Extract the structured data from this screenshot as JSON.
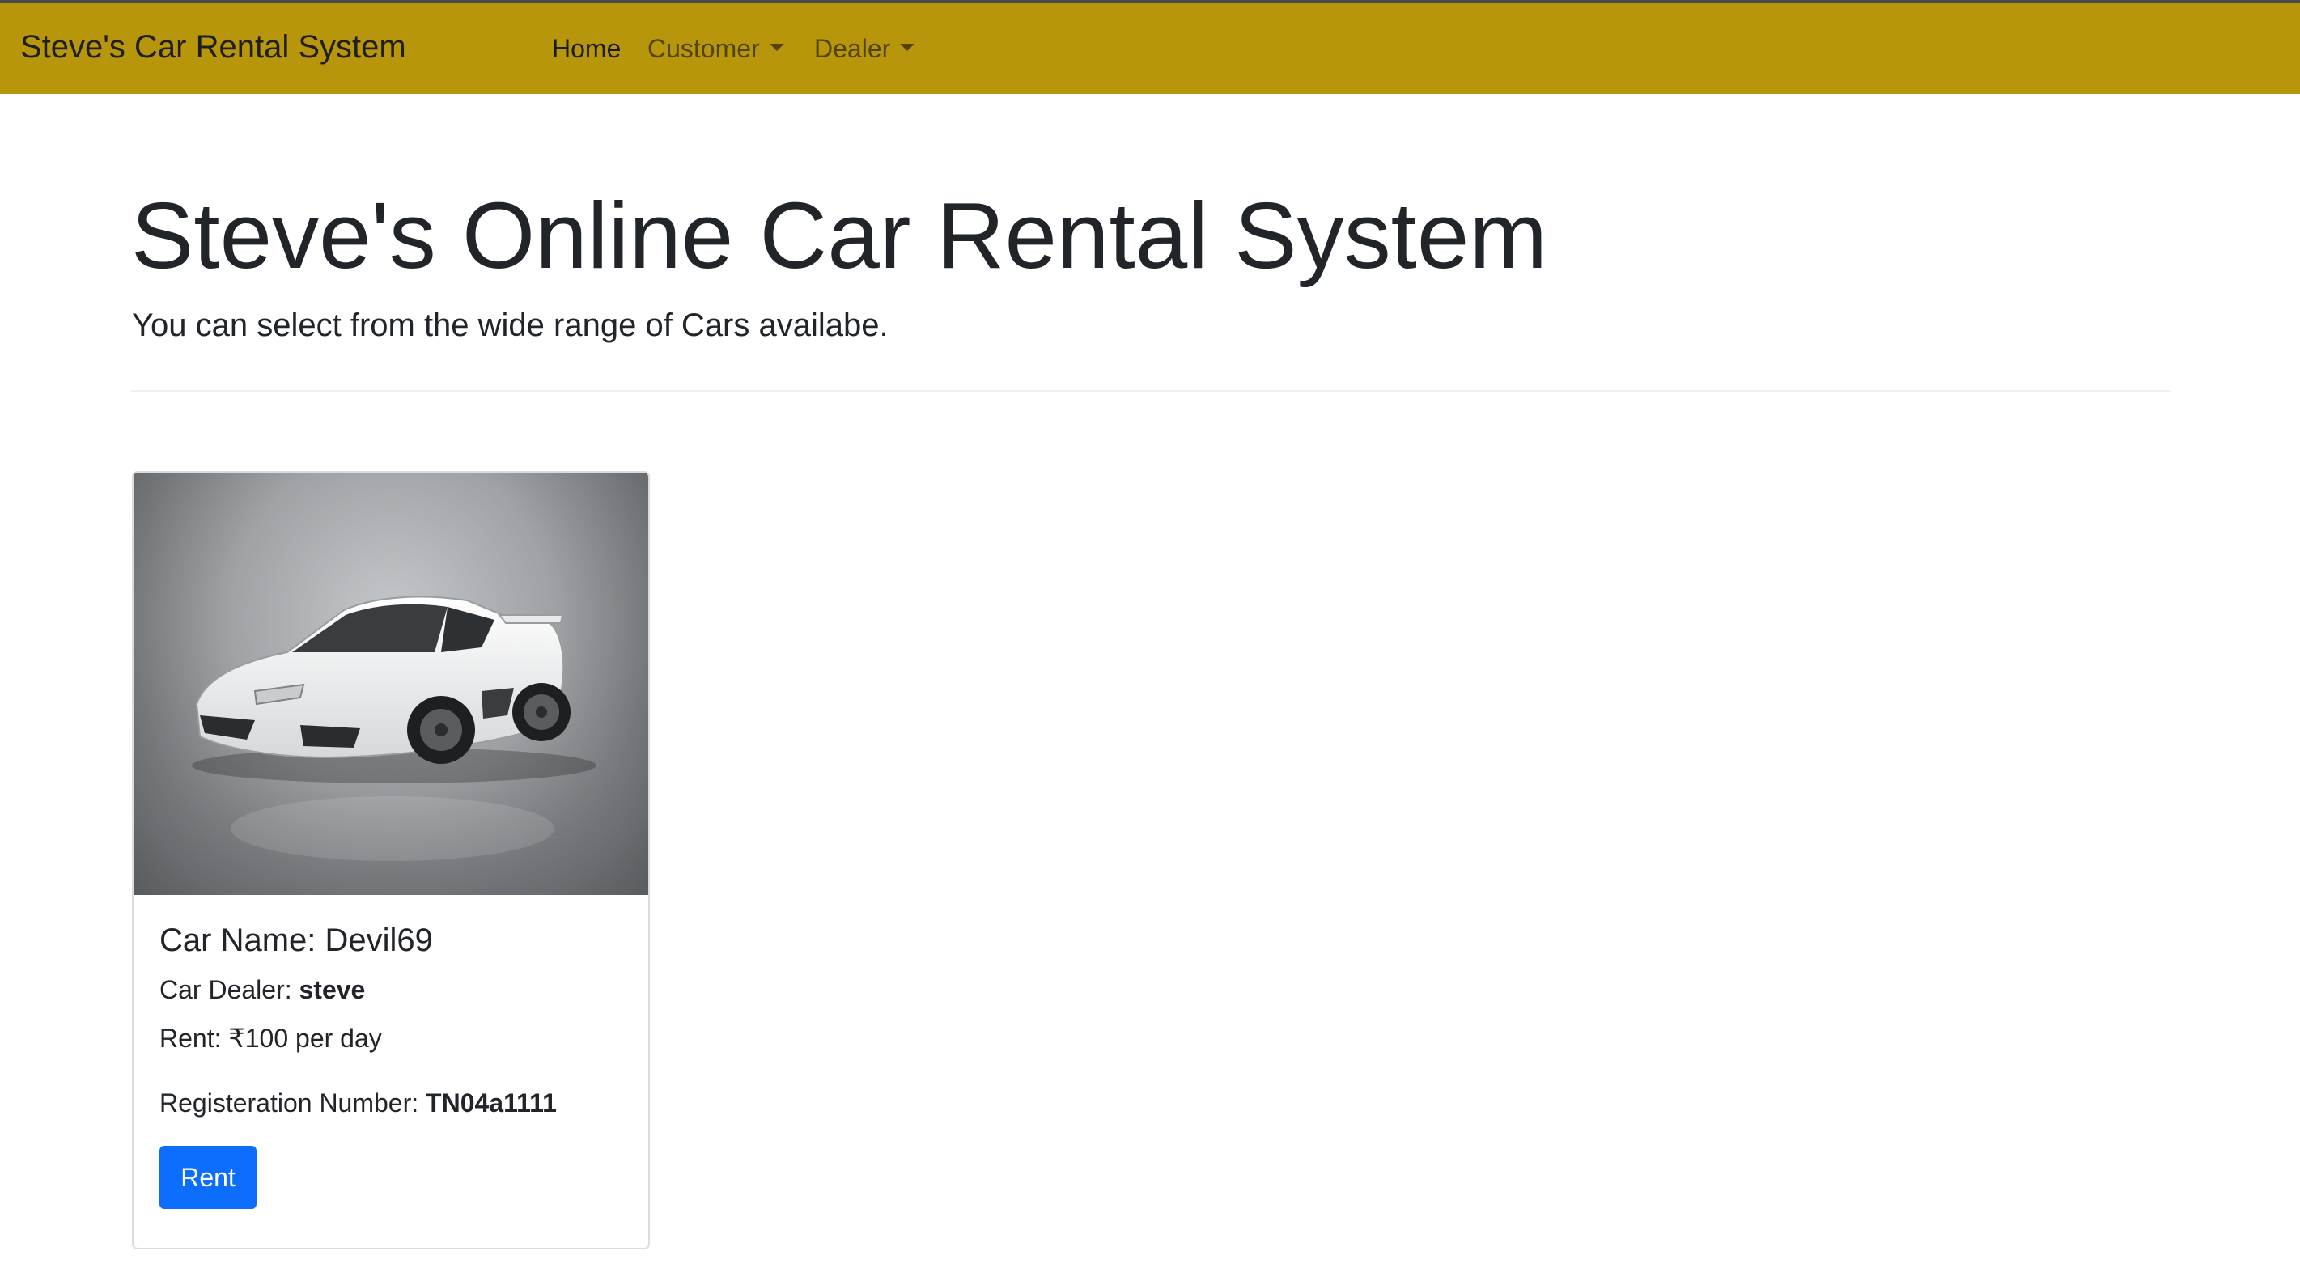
{
  "navbar": {
    "brand": "Steve's Car Rental System",
    "items": [
      {
        "label": "Home"
      },
      {
        "label": "Customer"
      },
      {
        "label": "Dealer"
      }
    ],
    "background_color": "#b8960b"
  },
  "hero": {
    "title": "Steve's Online Car Rental System",
    "lead": "You can select from the wide range of Cars availabe."
  },
  "cars": [
    {
      "name_label": "Car Name: Devil69",
      "dealer_label": "Car Dealer: ",
      "dealer": "steve",
      "rent": "Rent: ₹100 per day",
      "reg_label": "Registeration Number: ",
      "reg_number": "TN04a1111",
      "button_label": "Rent",
      "button_color": "#0d6efd"
    }
  ]
}
